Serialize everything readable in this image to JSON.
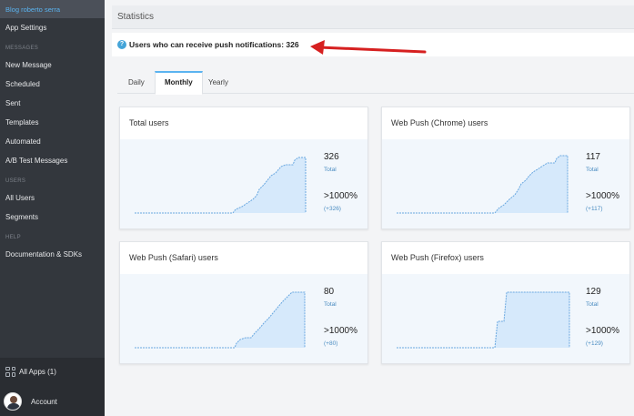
{
  "sidebar": {
    "brand": "Blog roberto serra",
    "app_settings": "App Settings",
    "section_messages": "MESSAGES",
    "messages_items": [
      "New Message",
      "Scheduled",
      "Sent",
      "Templates",
      "Automated",
      "A/B Test Messages"
    ],
    "section_users": "USERS",
    "users_items": [
      "All Users",
      "Segments"
    ],
    "section_help": "HELP",
    "help_items": [
      "Documentation & SDKs"
    ],
    "all_apps": "All Apps (1)",
    "account": "Account"
  },
  "header": {
    "title": "Statistics"
  },
  "info": {
    "text": "Users who can receive push notifications: 326"
  },
  "tabs": [
    {
      "label": "Daily",
      "active": false
    },
    {
      "label": "Monthly",
      "active": true
    },
    {
      "label": "Yearly",
      "active": false
    }
  ],
  "colors": {
    "accent": "#5ab3f0",
    "arrow": "#d62020",
    "area_fill": "#d6e9fb",
    "area_stroke": "#6aa8e0",
    "sidebar": "#33373d"
  },
  "cards": [
    {
      "title": "Total users",
      "value": "326",
      "value_label": "Total",
      "pct": ">1000%",
      "delta": "(+326)"
    },
    {
      "title": "Web Push (Chrome) users",
      "value": "117",
      "value_label": "Total",
      "pct": ">1000%",
      "delta": "(+117)"
    },
    {
      "title": "Web Push (Safari) users",
      "value": "80",
      "value_label": "Total",
      "pct": ">1000%",
      "delta": "(+80)"
    },
    {
      "title": "Web Push (Firefox) users",
      "value": "129",
      "value_label": "Total",
      "pct": ">1000%",
      "delta": "(+129)"
    }
  ]
}
